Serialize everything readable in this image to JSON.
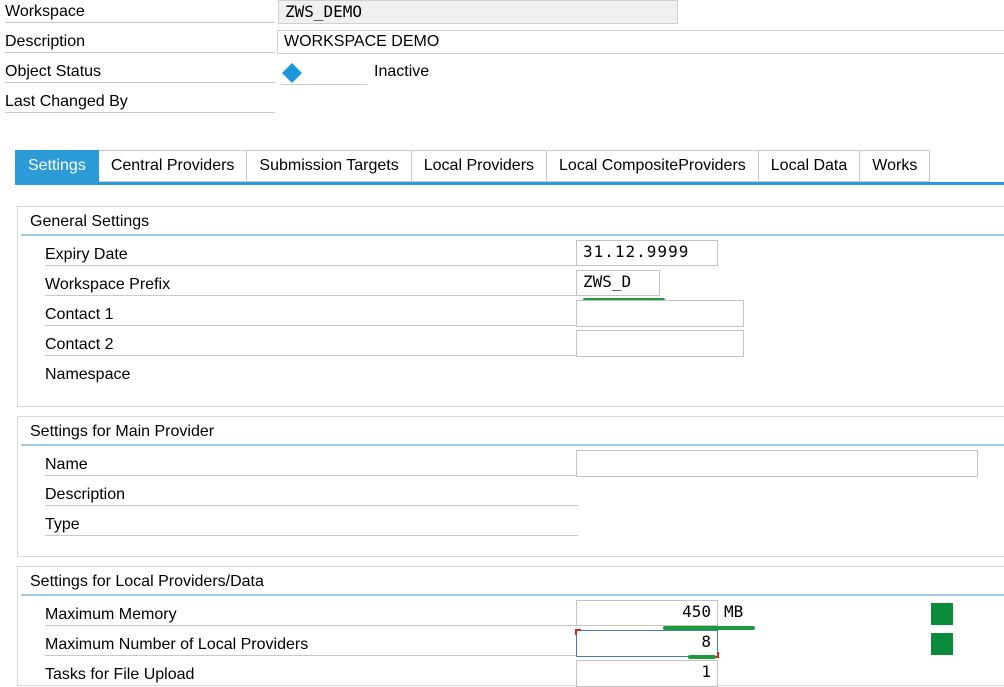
{
  "header": {
    "workspace_label": "Workspace",
    "workspace_value": "ZWS_DEMO",
    "description_label": "Description",
    "description_value": "WORKSPACE DEMO",
    "object_status_label": "Object Status",
    "object_status_value": "Inactive",
    "last_changed_label": "Last Changed By"
  },
  "tabs": [
    {
      "label": "Settings",
      "active": true
    },
    {
      "label": "Central Providers"
    },
    {
      "label": "Submission Targets"
    },
    {
      "label": "Local Providers"
    },
    {
      "label": "Local CompositeProviders"
    },
    {
      "label": "Local Data"
    },
    {
      "label": "Works"
    }
  ],
  "general": {
    "title": "General Settings",
    "expiry_label": "Expiry Date",
    "expiry_value": "31.12.9999",
    "prefix_label": "Workspace Prefix",
    "prefix_value": "ZWS_D",
    "contact1_label": "Contact 1",
    "contact1_value": "",
    "contact2_label": "Contact 2",
    "contact2_value": "",
    "namespace_label": "Namespace"
  },
  "main_provider": {
    "title": "Settings for Main Provider",
    "name_label": "Name",
    "name_value": "",
    "description_label": "Description",
    "type_label": "Type"
  },
  "local": {
    "title": "Settings for Local Providers/Data",
    "max_memory_label": "Maximum Memory",
    "max_memory_value": "450",
    "max_memory_unit": "MB",
    "max_providers_label": "Maximum Number of Local Providers",
    "max_providers_value": "8",
    "tasks_label": "Tasks for File Upload",
    "tasks_value": "1"
  },
  "colors": {
    "accent": "#2b9cd8",
    "status_icon": "#1e96dc",
    "highlight_green": "#0a8c3a"
  },
  "icons": {
    "status": "diamond-icon"
  }
}
